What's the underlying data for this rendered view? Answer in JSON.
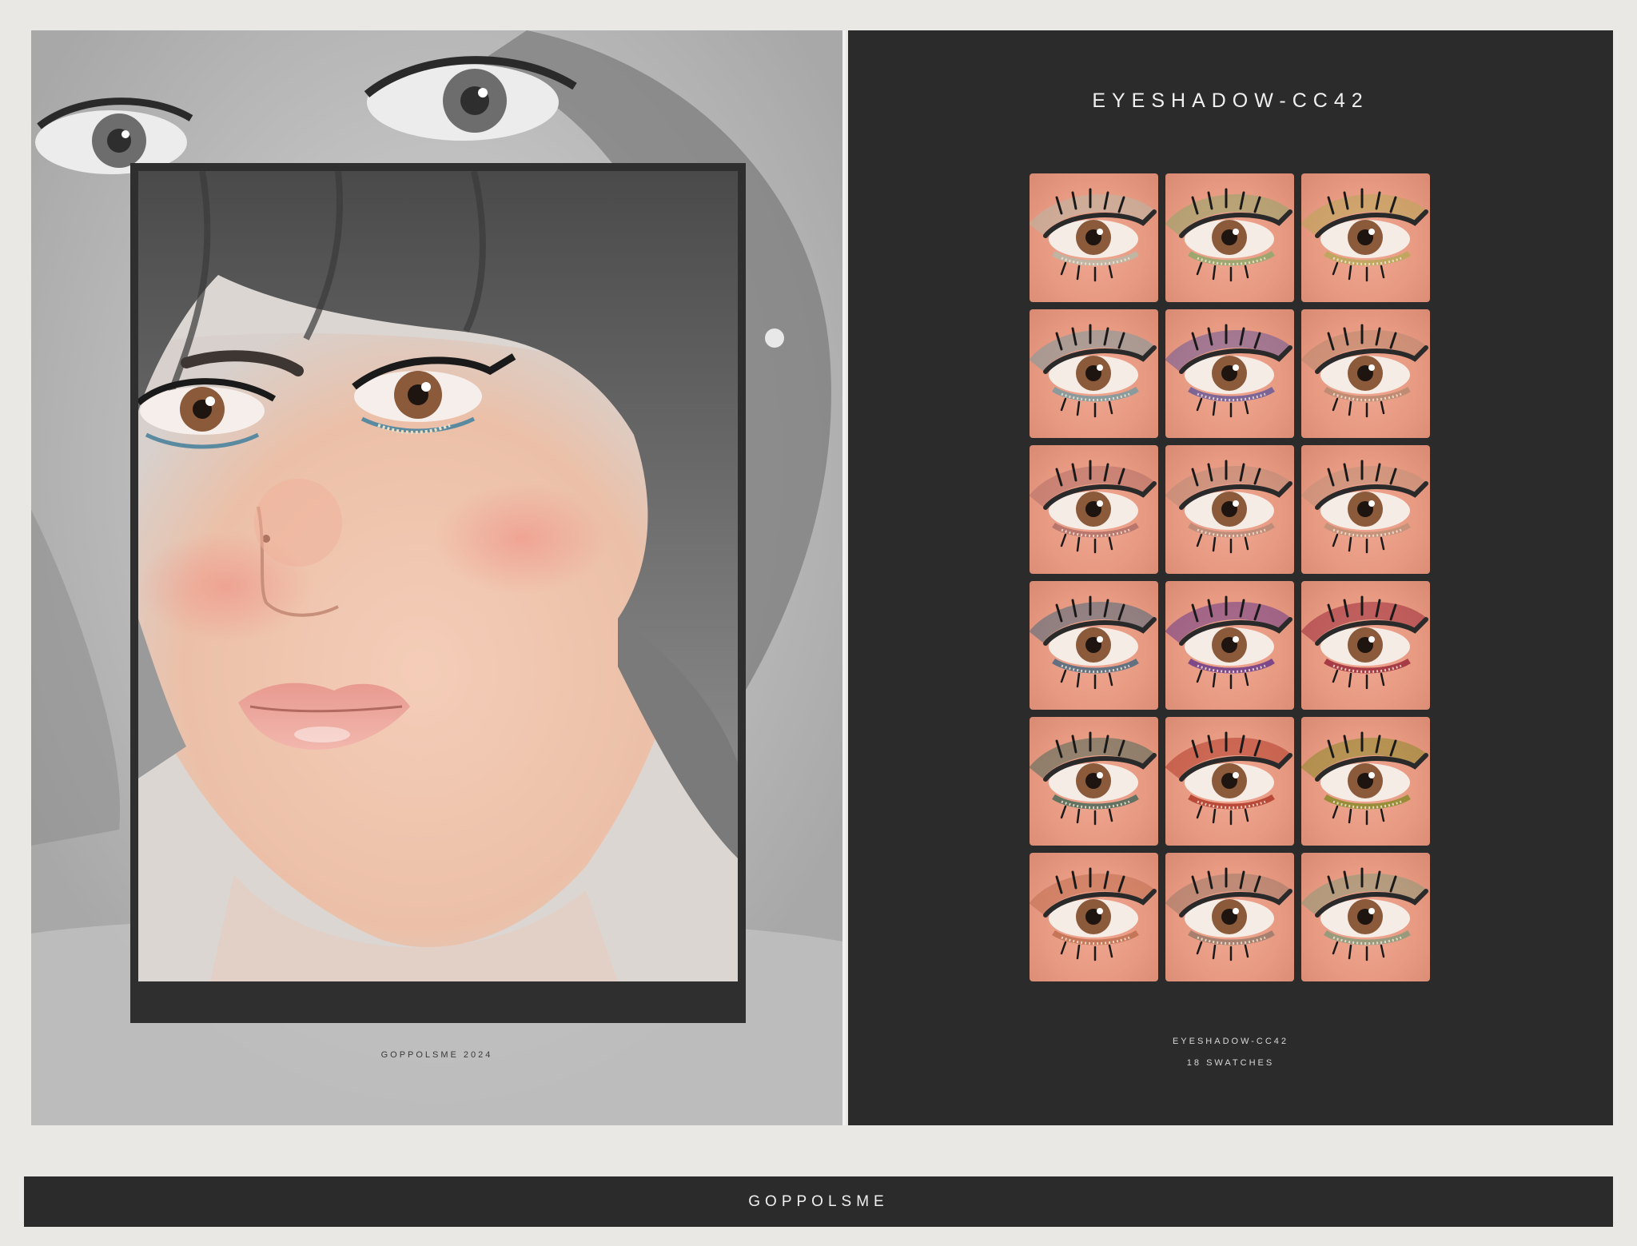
{
  "preview": {
    "credit": "GOPPOLSME 2024"
  },
  "product": {
    "title": "EYESHADOW-CC42",
    "footer_name": "EYESHADOW-CC42",
    "footer_count": "18 SWATCHES"
  },
  "brand": "GOPPOLSME",
  "colors": {
    "page_bg": "#e9e8e5",
    "panel_dark": "#2b2b2b",
    "skin": "#e89a82",
    "iris": "#8a5a3a"
  },
  "swatches": [
    {
      "shadow": "#b8b8a8",
      "liner": "#2a2a2a"
    },
    {
      "shadow": "#8fa86a",
      "liner": "#2a2a2a"
    },
    {
      "shadow": "#b8a858",
      "liner": "#2a2a2a"
    },
    {
      "shadow": "#7a9aa0",
      "liner": "#2a2a2a"
    },
    {
      "shadow": "#6a5a9a",
      "liner": "#2a2a2a"
    },
    {
      "shadow": "#b88870",
      "liner": "#2a2a2a"
    },
    {
      "shadow": "#b07068",
      "liner": "#2a2a2a"
    },
    {
      "shadow": "#b88a78",
      "liner": "#2a2a2a"
    },
    {
      "shadow": "#c09078",
      "liner": "#2a2a2a"
    },
    {
      "shadow": "#4a6a80",
      "liner": "#2a2a2a"
    },
    {
      "shadow": "#6a3a8a",
      "liner": "#2a2a2a"
    },
    {
      "shadow": "#9a2a3a",
      "liner": "#2a2a2a"
    },
    {
      "shadow": "#4a6a5a",
      "liner": "#2a2a2a"
    },
    {
      "shadow": "#b03a2a",
      "liner": "#2a2a2a"
    },
    {
      "shadow": "#8a8a2a",
      "liner": "#2a2a2a"
    },
    {
      "shadow": "#c07050",
      "liner": "#2a2a2a"
    },
    {
      "shadow": "#9a7a6a",
      "liner": "#2a2a2a"
    },
    {
      "shadow": "#8a9a7a",
      "liner": "#2a2a2a"
    }
  ]
}
